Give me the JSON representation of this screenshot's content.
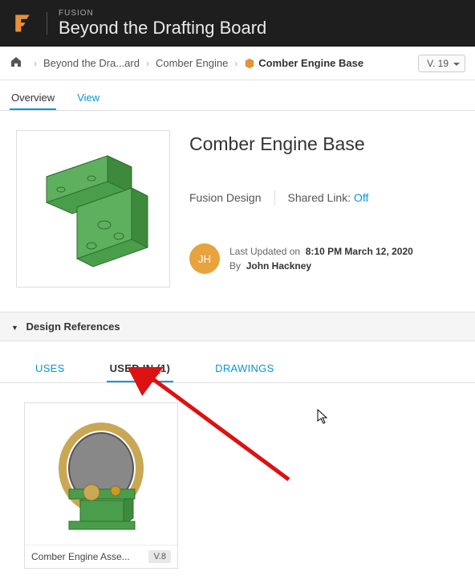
{
  "header": {
    "app": "FUSION",
    "project": "Beyond the Drafting Board"
  },
  "breadcrumb": {
    "items": [
      "Beyond the Dra...ard",
      "Comber Engine",
      "Comber Engine Base"
    ],
    "version": "V. 19"
  },
  "tabs": {
    "overview": "Overview",
    "view": "View"
  },
  "item": {
    "title": "Comber Engine Base",
    "type": "Fusion Design",
    "shared_label": "Shared Link:",
    "shared_value": "Off",
    "updated_label": "Last Updated on",
    "updated_value": "8:10 PM March 12, 2020",
    "by_label": "By",
    "author": "John Hackney",
    "initials": "JH"
  },
  "refs": {
    "section_title": "Design References",
    "tabs": {
      "uses": "USES",
      "used_in": "USED IN (1)",
      "drawings": "DRAWINGS"
    },
    "cards": [
      {
        "name": "Comber Engine Asse...",
        "version": "V.8"
      }
    ]
  }
}
